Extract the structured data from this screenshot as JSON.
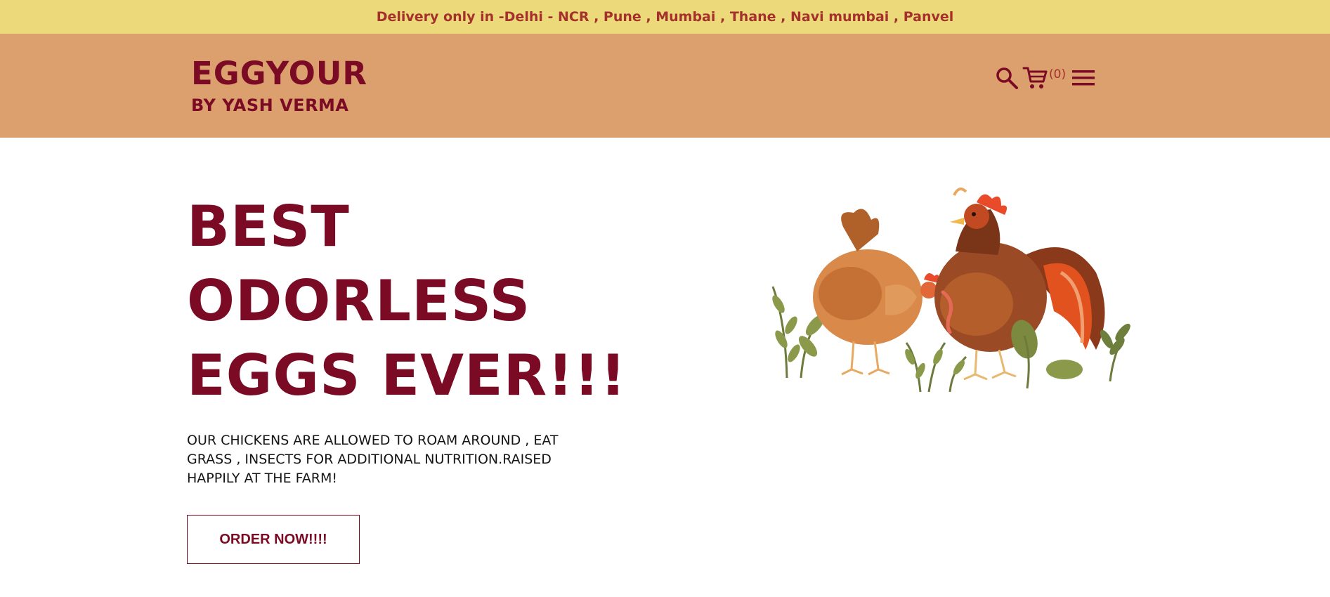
{
  "announcement": {
    "text": "Delivery only in -Delhi - NCR , Pune , Mumbai , Thane , Navi mumbai , Panvel"
  },
  "brand": {
    "title": "EGGYOUR",
    "subtitle": "BY YASH VERMA"
  },
  "header_icons": {
    "search": "search-icon",
    "cart": "cart-icon",
    "cart_count": "(0)",
    "menu": "hamburger-menu-icon"
  },
  "hero": {
    "title_lines": [
      "BEST",
      "ODORLESS",
      "EGGS EVER!!!"
    ],
    "description": "OUR CHICKENS ARE ALLOWED TO ROAM AROUND , EAT GRASS , INSECTS FOR ADDITIONAL NUTRITION.RAISED HAPPILY AT THE FARM!",
    "cta_label": "ORDER NOW!!!!"
  },
  "colors": {
    "announcement_bg": "#ecd979",
    "header_bg": "#dc9f6e",
    "brand": "#7b0b24",
    "accent": "#a5312c"
  }
}
